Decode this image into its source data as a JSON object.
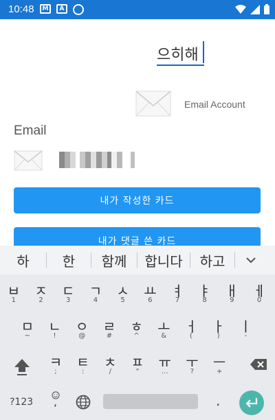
{
  "status": {
    "time": "10:48",
    "icons": [
      "gmail-icon",
      "text-a-icon",
      "data-saver-icon",
      "wifi-icon",
      "signal-icon",
      "battery-icon"
    ]
  },
  "app": {
    "input_text": "으히해",
    "email_account_label": "Email Account",
    "email_heading": "Email",
    "buttons": [
      "내가 작성한 카드",
      "내가 댓글 쓴 카드"
    ]
  },
  "keyboard": {
    "suggestions": [
      "하",
      "한",
      "함께",
      "합니다",
      "하고"
    ],
    "row1": [
      {
        "main": "ㅂ",
        "sub": "1"
      },
      {
        "main": "ㅈ",
        "sub": "2"
      },
      {
        "main": "ㄷ",
        "sub": "3"
      },
      {
        "main": "ㄱ",
        "sub": "4"
      },
      {
        "main": "ㅅ",
        "sub": "5"
      },
      {
        "main": "ㅛ",
        "sub": "6"
      },
      {
        "main": "ㅕ",
        "sub": "7"
      },
      {
        "main": "ㅑ",
        "sub": "8"
      },
      {
        "main": "ㅐ",
        "sub": "9"
      },
      {
        "main": "ㅔ",
        "sub": "0"
      }
    ],
    "row2": [
      {
        "main": "ㅁ",
        "sub": "~"
      },
      {
        "main": "ㄴ",
        "sub": "!"
      },
      {
        "main": "ㅇ",
        "sub": "@"
      },
      {
        "main": "ㄹ",
        "sub": "#"
      },
      {
        "main": "ㅎ",
        "sub": "^"
      },
      {
        "main": "ㅗ",
        "sub": "&"
      },
      {
        "main": "ㅓ",
        "sub": "("
      },
      {
        "main": "ㅏ",
        "sub": ")"
      },
      {
        "main": "ㅣ",
        "sub": "-"
      }
    ],
    "row3": [
      {
        "main": "ㅋ",
        "sub": ";"
      },
      {
        "main": "ㅌ",
        "sub": ":"
      },
      {
        "main": "ㅊ",
        "sub": "/"
      },
      {
        "main": "ㅍ",
        "sub": "\""
      },
      {
        "main": "ㅠ",
        "sub": "…"
      },
      {
        "main": "ㅜ",
        "sub": "?"
      },
      {
        "main": "ㅡ",
        "sub": "+"
      }
    ],
    "symbols_key": "?123",
    "comma_key": ",",
    "period_key": ".",
    "accent_color": "#4db6ac"
  }
}
